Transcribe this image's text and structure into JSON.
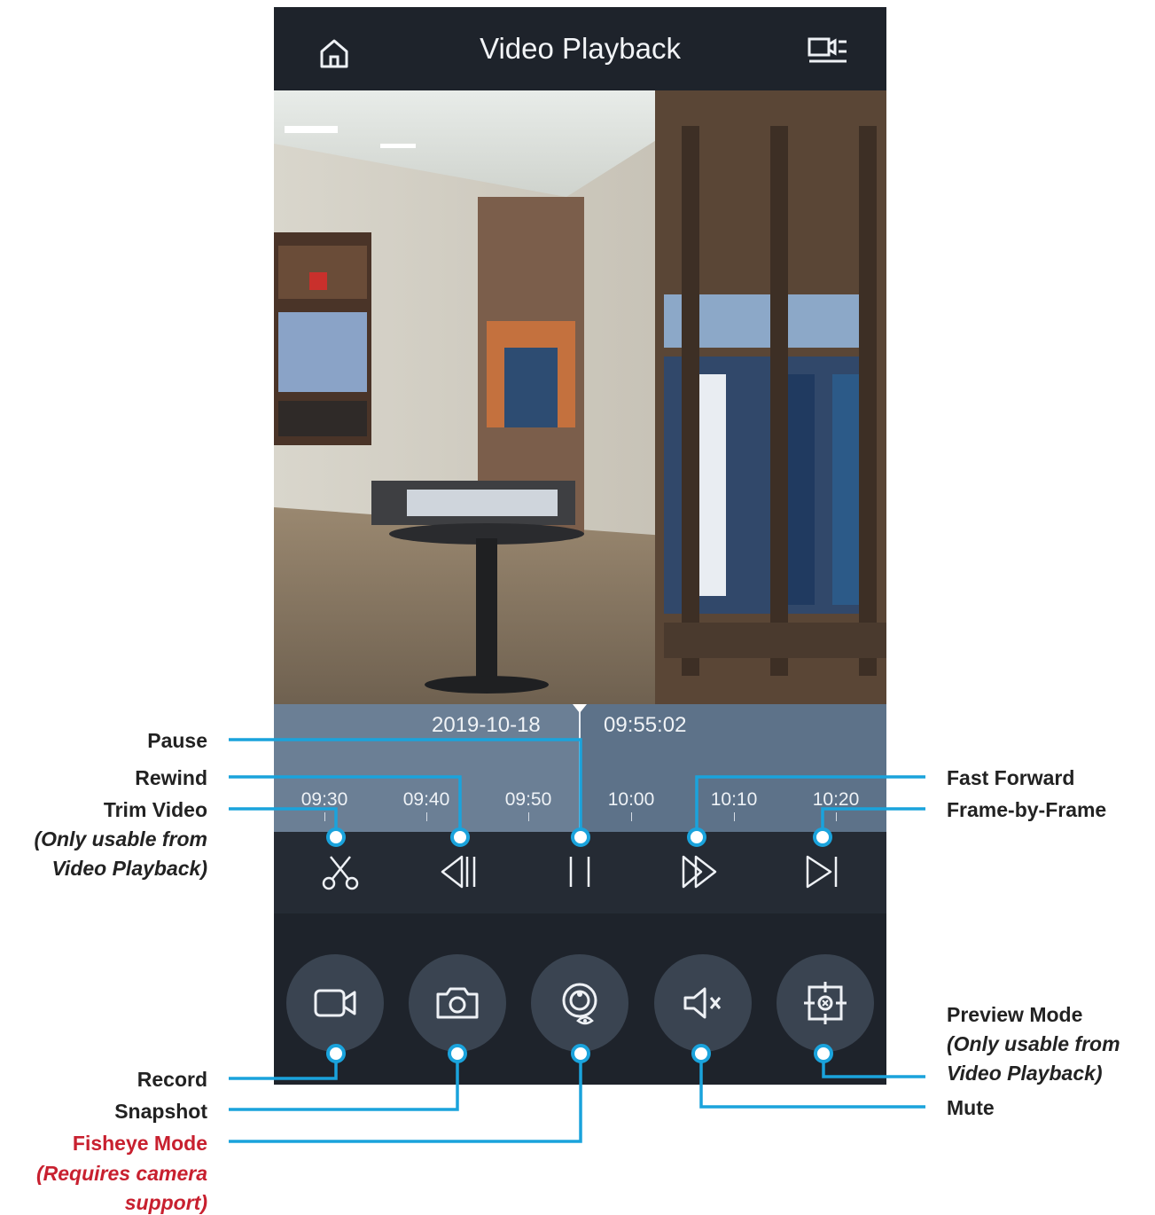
{
  "header": {
    "title": "Video Playback"
  },
  "timeline": {
    "date": "2019-10-18",
    "time": "09:55:02",
    "ticks": [
      "09:30",
      "09:40",
      "09:50",
      "10:00",
      "10:10",
      "10:20"
    ]
  },
  "controls": [
    {
      "name": "trim",
      "icon": "scissors-icon"
    },
    {
      "name": "rewind",
      "icon": "rewind-icon"
    },
    {
      "name": "pause",
      "icon": "pause-icon"
    },
    {
      "name": "fast-forward",
      "icon": "fast-forward-icon"
    },
    {
      "name": "frame-by-frame",
      "icon": "skip-forward-icon"
    }
  ],
  "bottom_buttons": [
    {
      "name": "record",
      "icon": "video-camera-icon"
    },
    {
      "name": "snapshot",
      "icon": "camera-icon"
    },
    {
      "name": "fisheye",
      "icon": "fisheye-icon"
    },
    {
      "name": "mute",
      "icon": "speaker-mute-icon"
    },
    {
      "name": "preview",
      "icon": "preview-mode-icon"
    }
  ],
  "labels": {
    "pause": "Pause",
    "rewind": "Rewind",
    "trim": "Trim Video",
    "trim_note_1": "(Only usable from",
    "trim_note_2": "Video Playback)",
    "fast_forward": "Fast Forward",
    "frame_by_frame": "Frame-by-Frame",
    "preview_mode": "Preview Mode",
    "preview_note_1": "(Only usable from",
    "preview_note_2": "Video Playback)",
    "record": "Record",
    "snapshot": "Snapshot",
    "fisheye": "Fisheye Mode",
    "fisheye_note_1": "(Requires camera",
    "fisheye_note_2": "support)",
    "mute": "Mute"
  },
  "colors": {
    "callout": "#1aa3dc",
    "warning": "#c8202f",
    "app_bg": "#1e232b",
    "timeline": "#5d7289"
  }
}
